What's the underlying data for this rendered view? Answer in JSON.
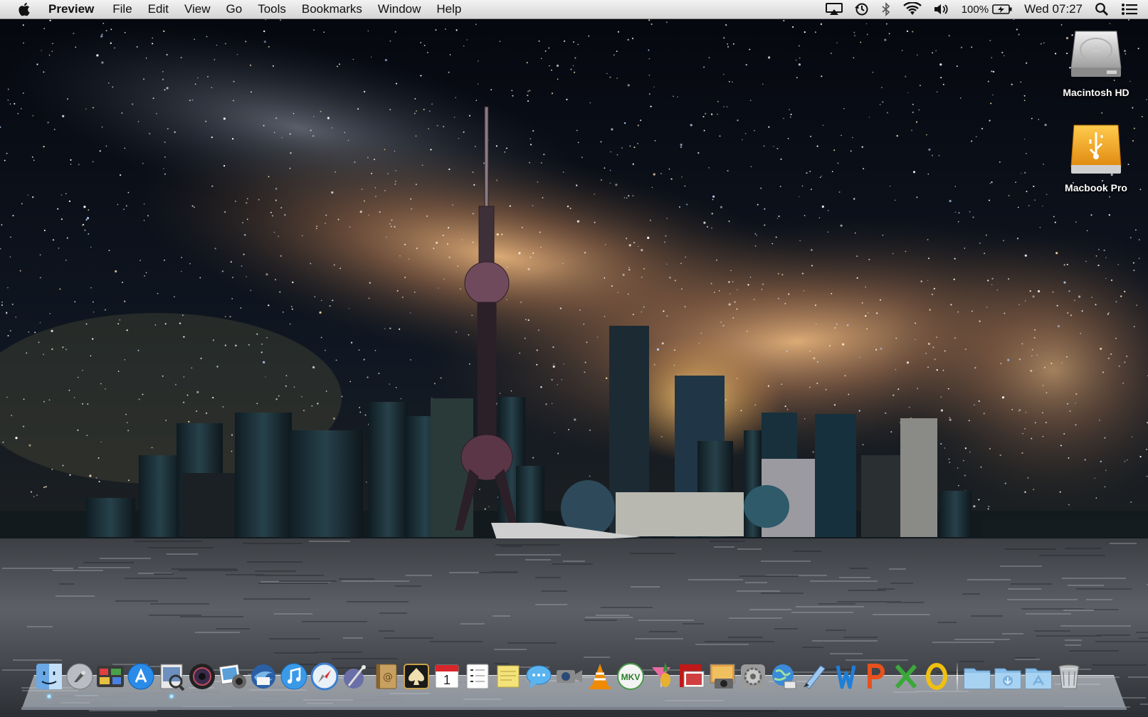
{
  "menubar": {
    "apple_icon": "apple-logo-icon",
    "app_name": "Preview",
    "menus": [
      "File",
      "Edit",
      "View",
      "Go",
      "Tools",
      "Bookmarks",
      "Window",
      "Help"
    ],
    "status": {
      "icons": [
        "airplay-icon",
        "time-machine-icon",
        "bluetooth-icon",
        "wifi-icon",
        "volume-icon"
      ],
      "battery_percent": "100%",
      "battery_icon": "battery-charging-icon",
      "clock": "Wed 07:27",
      "search_icon": "spotlight-search-icon",
      "notifications_icon": "notification-center-icon"
    }
  },
  "desktop": {
    "icons": [
      {
        "label": "Macintosh HD",
        "icon": "hard-drive-icon"
      },
      {
        "label": "Macbook Pro",
        "icon": "usb-drive-icon"
      }
    ]
  },
  "dock": {
    "apps": [
      {
        "icon": "finder-icon",
        "running": true
      },
      {
        "icon": "launchpad-icon",
        "running": false
      },
      {
        "icon": "mission-control-icon",
        "running": false
      },
      {
        "icon": "app-store-icon",
        "running": false
      },
      {
        "icon": "preview-icon",
        "running": true
      },
      {
        "icon": "photo-booth-icon",
        "running": false
      },
      {
        "icon": "iphoto-icon",
        "running": false
      },
      {
        "icon": "thunderbird-icon",
        "running": false
      },
      {
        "icon": "itunes-icon",
        "running": false
      },
      {
        "icon": "safari-icon",
        "running": false
      },
      {
        "icon": "script-editor-icon",
        "running": false
      },
      {
        "icon": "address-book-icon",
        "running": false
      },
      {
        "icon": "solitaire-icon",
        "running": false
      },
      {
        "icon": "calendar-icon",
        "running": false
      },
      {
        "icon": "reminders-icon",
        "running": false
      },
      {
        "icon": "stickies-icon",
        "running": false
      },
      {
        "icon": "messages-icon",
        "running": false
      },
      {
        "icon": "facetime-icon",
        "running": false
      },
      {
        "icon": "vlc-icon",
        "running": false
      },
      {
        "icon": "mkv-player-icon",
        "running": false
      },
      {
        "icon": "cocktail-icon",
        "running": false
      },
      {
        "icon": "photo-slideshow-icon",
        "running": false
      },
      {
        "icon": "image-capture-icon",
        "running": false
      },
      {
        "icon": "system-preferences-icon",
        "running": false
      },
      {
        "icon": "network-globe-icon",
        "running": false
      },
      {
        "icon": "pages-writer-icon",
        "running": false
      },
      {
        "icon": "word-icon",
        "running": false
      },
      {
        "icon": "powerpoint-icon",
        "running": false
      },
      {
        "icon": "excel-icon",
        "running": false
      },
      {
        "icon": "outlook-icon",
        "running": false
      }
    ],
    "folders": [
      {
        "icon": "applications-folder-icon"
      },
      {
        "icon": "downloads-folder-icon"
      },
      {
        "icon": "documents-folder-icon"
      },
      {
        "icon": "trash-icon"
      }
    ],
    "calendar_day": "1"
  },
  "colors": {
    "menubar_top": "#f3f3f3",
    "menubar_bottom": "#d4d4d4",
    "sky": "#0a0f1c",
    "milky_way": "#c7906a",
    "water": "#4a4d52"
  }
}
